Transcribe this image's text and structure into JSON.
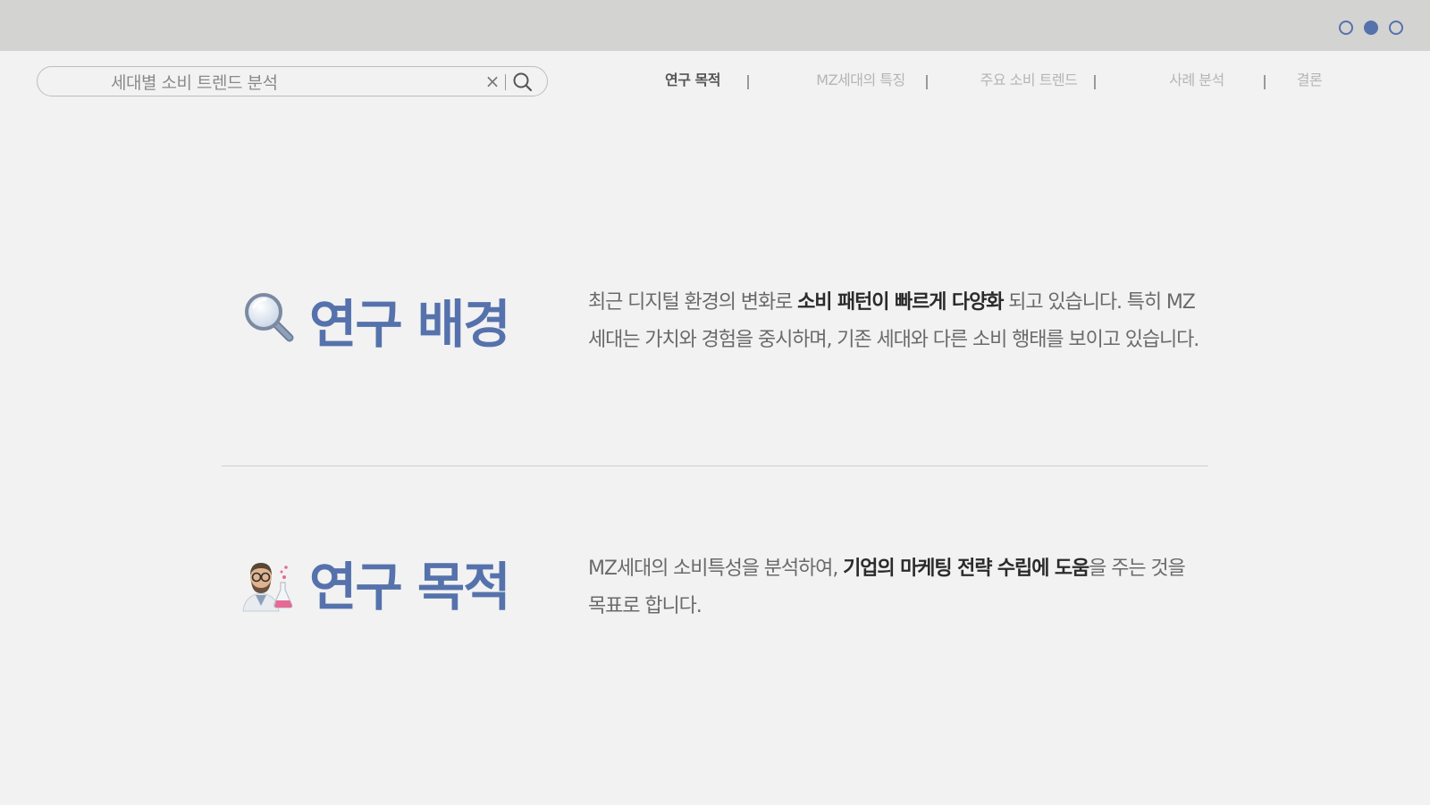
{
  "pagination": {
    "dots": [
      "page-1",
      "page-2",
      "page-3"
    ],
    "active_index": 1
  },
  "search": {
    "value": "세대별 소비 트렌드 분석",
    "clear_label": "×"
  },
  "nav": {
    "items": [
      "연구 목적",
      "MZ세대의 특징",
      "주요 소비 트렌드",
      "사례 분석",
      "결론"
    ],
    "active_index": 0
  },
  "sections": [
    {
      "icon": "magnifying-glass-icon",
      "title": "연구 배경",
      "text_parts": [
        "최근 디지털 환경의 변화로 ",
        "소비 패턴이 빠르게 다양화",
        " 되고 있습니다. 특히 MZ세대는 가치와 경험을 중시하며, 기존 세대와 다른 소비 행태를 보이고 있습니다."
      ]
    },
    {
      "icon": "scientist-icon",
      "title": "연구 목적",
      "text_parts": [
        "MZ세대의 소비특성을 분석하여, ",
        "기업의 마케팅 전략 수립에 도움",
        "을 주는 것을 목표로 합니다."
      ]
    }
  ],
  "colors": {
    "accent": "#5572ac",
    "topbar": "#d3d3d1",
    "background": "#f2f2f2"
  }
}
